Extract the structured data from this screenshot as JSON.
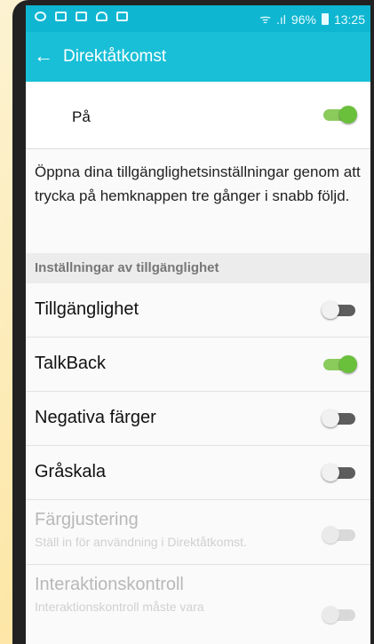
{
  "status": {
    "signal_text": ".ıl",
    "battery": "96%",
    "time": "13:25"
  },
  "appbar": {
    "title": "Direktåtkomst"
  },
  "master": {
    "label": "På",
    "state": "on"
  },
  "description": "Öppna dina tillgänglighetsinställningar genom att trycka på hemknappen tre gånger i snabb följd.",
  "section": {
    "header": "Inställningar av tillgänglighet"
  },
  "items": [
    {
      "label": "Tillgänglighet",
      "state": "off",
      "enabled": true
    },
    {
      "label": "TalkBack",
      "state": "on",
      "enabled": true
    },
    {
      "label": "Negativa färger",
      "state": "off",
      "enabled": true
    },
    {
      "label": "Gråskala",
      "state": "off",
      "enabled": true
    },
    {
      "label": "Färgjustering",
      "sublabel": "Ställ in för användning i Direktåtkomst.",
      "state": "off",
      "enabled": false
    },
    {
      "label": "Interaktionskontroll",
      "sublabel": "Interaktionskontroll måste vara",
      "state": "off",
      "enabled": false
    }
  ],
  "colors": {
    "accent": "#19bfd7",
    "toggle_on": "#6ac03b"
  }
}
